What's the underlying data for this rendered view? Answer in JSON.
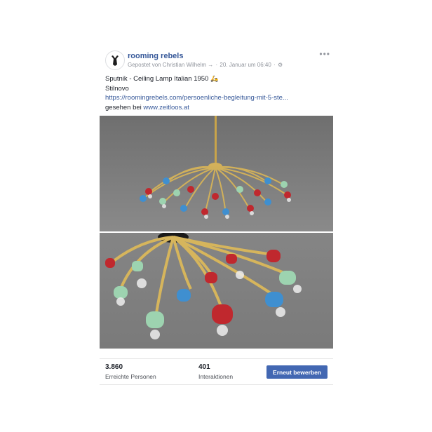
{
  "post": {
    "page_name": "rooming rebels",
    "meta": {
      "posted_by": "Gepostet von Christian Wilhelm",
      "posted_by_icon": "arrow-icon",
      "date": "20. Januar um 06:40",
      "audience_icon": "gear-icon"
    },
    "more_icon": "ellipsis-icon",
    "text": {
      "title": "Sputnik - Ceiling Lamp Italian 1950",
      "title_emoji": "scooter-icon",
      "maker": "Stilnovo",
      "link": "https://roomingrebels.com/persoenliche-begleitung-mit-5-ste...",
      "seen_prefix": "gesehen bei",
      "seen_link": "www.zeitloos.at"
    },
    "photos": [
      "sputnik-chandelier-photo",
      "sputnik-chandelier-closeup-photo"
    ]
  },
  "insights": {
    "reach_value": "3.860",
    "reach_label": "Erreichte Personen",
    "engagement_value": "401",
    "engagement_label": "Interaktionen",
    "boost_label": "Erneut bewerben"
  },
  "colors": {
    "link": "#365899",
    "boost_button": "#4267b2",
    "lamp_red": "#c0282e",
    "lamp_blue": "#3f8fd0",
    "lamp_mint": "#9dd3b0",
    "brass": "#c9a44a"
  }
}
